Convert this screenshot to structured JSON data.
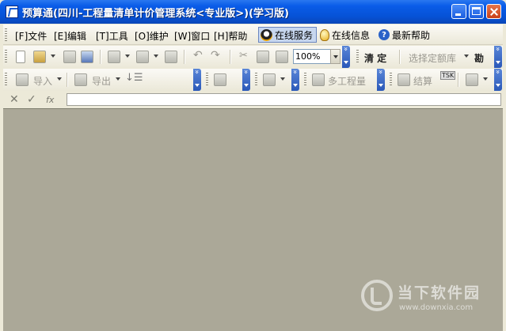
{
  "window": {
    "title": "预算通(四川-工程量清单计价管理系统<专业版>)(学习版)"
  },
  "menu": {
    "items": [
      "[F]文件",
      "[E]编辑",
      "[T]工具",
      "[O]维护",
      "[W]窗口",
      "[H]帮助"
    ],
    "buttons": [
      {
        "label": "在线服务",
        "icon": "qq-icon"
      },
      {
        "label": "在线信息",
        "icon": "bulb-icon"
      },
      {
        "label": "最新帮助",
        "icon": "help-icon"
      }
    ]
  },
  "toolbar1": {
    "zoom": "100%",
    "clear_label": "清 定",
    "library_label": "选择定额库",
    "extra_label": "勘"
  },
  "toolbar2": {
    "import_label": "导入",
    "export_label": "导出",
    "multi_project_label": "多工程量",
    "settle_label": "结算",
    "tsk_label": "TSK"
  },
  "formula": {
    "cancel_glyph": "✕",
    "confirm_glyph": "✓",
    "fx_glyph": "fx",
    "value": ""
  },
  "watermark": {
    "name": "当下软件园",
    "url": "www.downxia.com"
  }
}
